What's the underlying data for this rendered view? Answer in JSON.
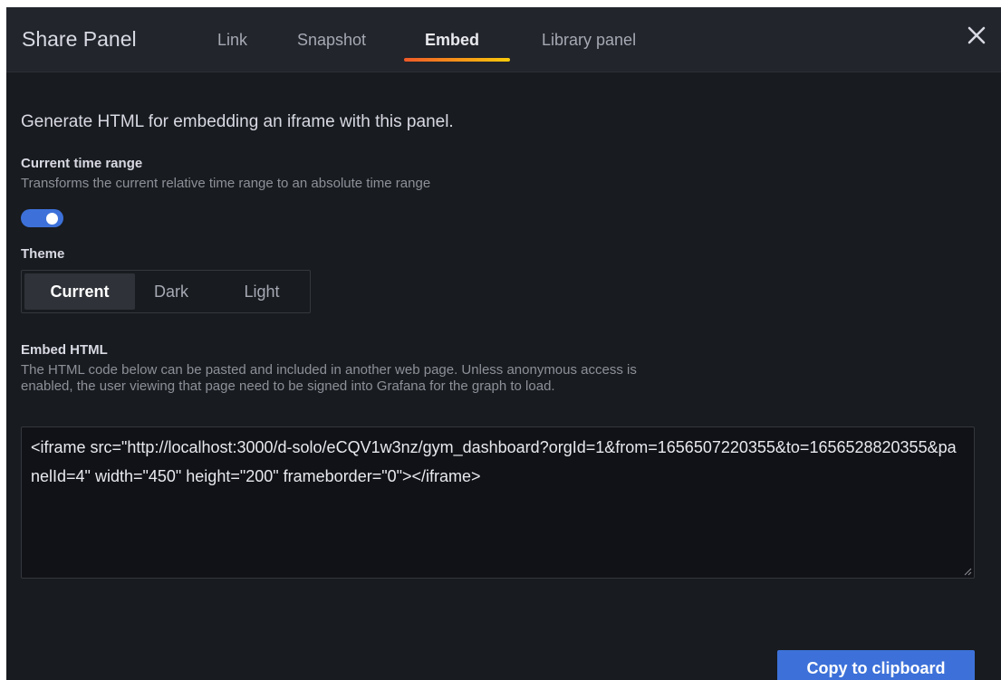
{
  "dialog": {
    "title": "Share Panel",
    "close_icon": "close-icon"
  },
  "tabs": [
    {
      "label": "Link",
      "active": false
    },
    {
      "label": "Snapshot",
      "active": false
    },
    {
      "label": "Embed",
      "active": true
    },
    {
      "label": "Library panel",
      "active": false
    }
  ],
  "embed": {
    "intro": "Generate HTML for embedding an iframe with this panel.",
    "time_range": {
      "label": "Current time range",
      "description": "Transforms the current relative time range to an absolute time range",
      "enabled": true
    },
    "theme": {
      "label": "Theme",
      "options": [
        "Current",
        "Dark",
        "Light"
      ],
      "selected": "Current"
    },
    "embed_html": {
      "label": "Embed HTML",
      "description": "The HTML code below can be pasted and included in another web page. Unless anonymous access is enabled, the user viewing that page need to be signed into Grafana for the graph to load.",
      "code": "<iframe src=\"http://localhost:3000/d-solo/eCQV1w3nz/gym_dashboard?orgId=1&from=1656507220355&to=1656528820355&panelId=4\" width=\"450\" height=\"200\" frameborder=\"0\"></iframe>"
    },
    "copy_button": "Copy to clipboard"
  },
  "colors": {
    "background": "#181b1f",
    "header": "#22252b",
    "primary": "#3d71d9",
    "tab_gradient_start": "#f05a28",
    "tab_gradient_end": "#fbca0a"
  }
}
